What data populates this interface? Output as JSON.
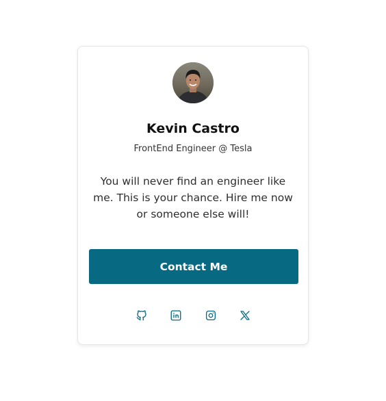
{
  "profile": {
    "name": "Kevin Castro",
    "role": "FrontEnd Engineer @ Tesla",
    "bio": "You will never find an engineer like me. This is your chance. Hire me now or someone else will!",
    "avatar_alt": "Kevin Castro profile photo"
  },
  "actions": {
    "contact_label": "Contact Me"
  },
  "socials": [
    {
      "icon": "github-icon",
      "label": "GitHub"
    },
    {
      "icon": "linkedin-icon",
      "label": "LinkedIn"
    },
    {
      "icon": "instagram-icon",
      "label": "Instagram"
    },
    {
      "icon": "x-twitter-icon",
      "label": "X"
    }
  ],
  "colors": {
    "accent": "#086983",
    "text": "#111111",
    "background": "#ffffff"
  }
}
